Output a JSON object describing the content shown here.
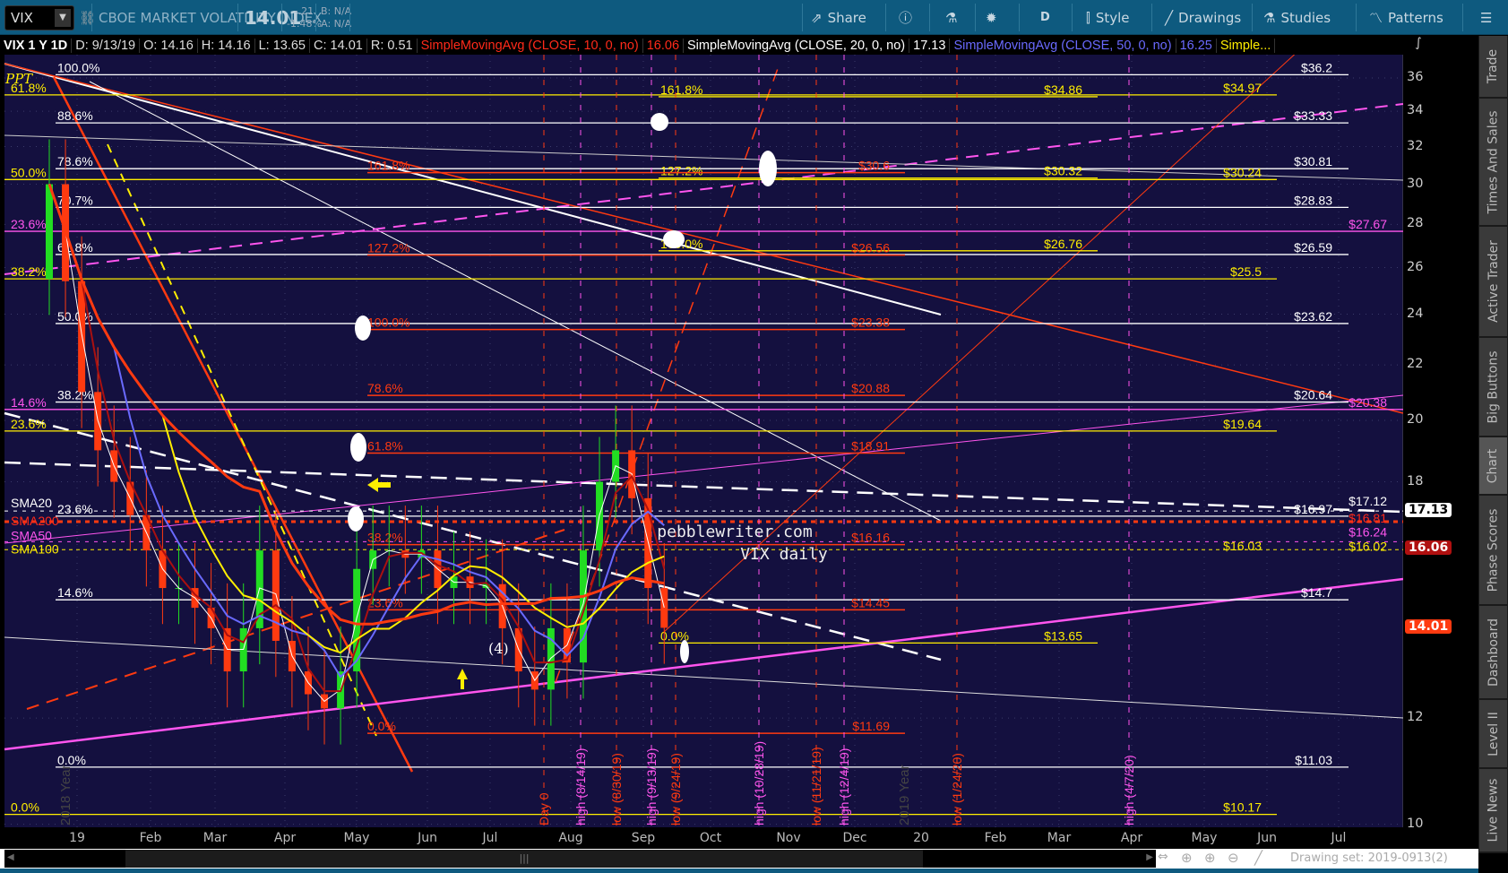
{
  "toolbar": {
    "symbol": "VIX",
    "description": "CBOE MARKET VOLATILITY INDEX",
    "last": "14.01",
    "change": "-.21",
    "change_pct": "-1.48%",
    "bid": "B: N/A",
    "ask": "A: N/A",
    "share": "Share",
    "period": "D",
    "style": "Style",
    "drawings": "Drawings",
    "studies": "Studies",
    "patterns": "Patterns"
  },
  "infobar": {
    "title": "VIX 1 Y 1D",
    "date": "D: 9/13/19",
    "open": "O: 14.16",
    "high": "H: 14.16",
    "low": "L: 13.65",
    "close": "C: 14.01",
    "range": "R: 0.51",
    "studies": [
      {
        "label": "SimpleMovingAvg (CLOSE, 10, 0, no)",
        "value": "16.06",
        "color": "#ff2a1a"
      },
      {
        "label": "SimpleMovingAvg (CLOSE, 20, 0, no)",
        "value": "17.13",
        "color": "#ffffff"
      },
      {
        "label": "SimpleMovingAvg (CLOSE, 50, 0, no)",
        "value": "16.25",
        "color": "#6a6aff"
      },
      {
        "label": "Simple...",
        "value": "",
        "color": "#ffee00"
      }
    ]
  },
  "sidebar": {
    "tabs": [
      "Trade",
      "Times And Sales",
      "Active Trader",
      "Big Buttons",
      "Chart",
      "Phase Scores",
      "Dashboard",
      "Level II",
      "Live News"
    ],
    "selected": "Chart"
  },
  "chart_data": {
    "type": "candlestick",
    "symbol": "VIX",
    "scale": "log",
    "ylim": [
      10,
      37
    ],
    "y_ticks": [
      36,
      34,
      32,
      30,
      28,
      26,
      24,
      22,
      20,
      18,
      12,
      10
    ],
    "x_ticks": [
      "19",
      "Feb",
      "Mar",
      "Apr",
      "May",
      "Jun",
      "Jul",
      "Aug",
      "Sep",
      "Oct",
      "Nov",
      "Dec",
      "20",
      "Feb",
      "Mar",
      "Apr",
      "May",
      "Jun",
      "Jul"
    ],
    "weekly_closes_from_2018_12_21": [
      30,
      25.4,
      21,
      19,
      18,
      17,
      16,
      15,
      15,
      14.5,
      14,
      13,
      14,
      16,
      13.7,
      13,
      12.5,
      12.2,
      13,
      15.5,
      16,
      16,
      15.8,
      16,
      15,
      15.3,
      15,
      15.1,
      14,
      13,
      12.6,
      14,
      13.2,
      16,
      18,
      19,
      17.5,
      15,
      14.01
    ],
    "price_tags": [
      {
        "value": "17.13",
        "bg": "#ffffff",
        "fg": "#000000"
      },
      {
        "value": "16.06",
        "bg": "#b01010",
        "fg": "#ffffff"
      },
      {
        "value": "14.01",
        "bg": "#ff3a10",
        "fg": "#ffffff"
      }
    ],
    "fib_white": [
      {
        "pct": "100.0%",
        "price": "$36.2",
        "v": 36.2
      },
      {
        "pct": "88.6%",
        "price": "$33.33",
        "v": 33.33
      },
      {
        "pct": "78.6%",
        "price": "$30.81",
        "v": 30.81
      },
      {
        "pct": "70.7%",
        "price": "$28.83",
        "v": 28.83
      },
      {
        "pct": "61.8%",
        "price": "$26.59",
        "v": 26.59
      },
      {
        "pct": "50.0%",
        "price": "$23.62",
        "v": 23.62
      },
      {
        "pct": "38.2%",
        "price": "$20.64",
        "v": 20.64
      },
      {
        "pct": "23.6%",
        "price": "$16.97",
        "v": 16.97
      },
      {
        "pct": "14.6%",
        "price": "$14.7",
        "v": 14.7
      },
      {
        "pct": "0.0%",
        "price": "$11.03",
        "v": 11.03
      }
    ],
    "fib_yellow": [
      {
        "pct": "61.8%",
        "price": "$34.97",
        "v": 34.97
      },
      {
        "pct": "50.0%",
        "price": "$30.24",
        "v": 30.24
      },
      {
        "pct": "38.2%",
        "price": "$25.5",
        "v": 25.5
      },
      {
        "pct": "23.6%",
        "price": "$19.64",
        "v": 19.64
      },
      {
        "pct": "0.0%",
        "price": "$10.17",
        "v": 10.17
      }
    ],
    "fib_magenta": [
      {
        "pct": "23.6%",
        "price": "$27.67",
        "v": 27.67
      },
      {
        "pct": "14.6%",
        "price": "$20.38",
        "v": 20.38
      }
    ],
    "fib_yellow_aug": [
      {
        "pct": "161.8%",
        "price": "$34.86",
        "v": 34.86
      },
      {
        "pct": "127.2%",
        "price": "$30.32",
        "v": 30.32
      },
      {
        "pct": "100.0%",
        "price": "$26.76",
        "v": 26.76
      },
      {
        "pct": "0.0%",
        "price": "$13.65",
        "v": 13.65
      }
    ],
    "fib_red": [
      {
        "pct": "161.8%",
        "price": "$30.6",
        "v": 30.6
      },
      {
        "pct": "127.2%",
        "price": "$26.56",
        "v": 26.56
      },
      {
        "pct": "100.0%",
        "price": "$23.38",
        "v": 23.38
      },
      {
        "pct": "78.6%",
        "price": "$20.88",
        "v": 20.88
      },
      {
        "pct": "61.8%",
        "price": "$18.91",
        "v": 18.91
      },
      {
        "pct": "38.2%",
        "price": "$16.16",
        "v": 16.16
      },
      {
        "pct": "23.6%",
        "price": "$14.45",
        "v": 14.45
      },
      {
        "pct": "0.0%",
        "price": "$11.69",
        "v": 11.69
      }
    ],
    "right_labels": [
      {
        "text": "$17.12",
        "v": 17.12,
        "color": "#ffffff"
      },
      {
        "text": "$16.81",
        "v": 16.81,
        "color": "#ff2a1a"
      },
      {
        "text": "$16.24",
        "v": 16.24,
        "color": "#ff55ee"
      },
      {
        "text": "$16.02",
        "v": 16.02,
        "color": "#ffee00"
      },
      {
        "text": "$16.03",
        "v": 16.03,
        "color": "#ffee00"
      }
    ],
    "sma_labels": [
      {
        "text": "SMA20",
        "color": "#ffffff"
      },
      {
        "text": "SMA200",
        "color": "#ff2a1a"
      },
      {
        "text": "SMA50",
        "color": "#ff55ee"
      },
      {
        "text": "SMA100",
        "color": "#ffee00"
      }
    ],
    "events": [
      {
        "text": "Day 0",
        "color": "#ff3a10"
      },
      {
        "text": "high (8/14/19)",
        "color": "#ff55ee"
      },
      {
        "text": "low (8/30/19)",
        "color": "#ff3a10"
      },
      {
        "text": "high (9/13/19)",
        "color": "#ff55ee"
      },
      {
        "text": "low (9/24/19)",
        "color": "#ff3a10"
      },
      {
        "text": "high (10/28/19)",
        "color": "#ff55ee"
      },
      {
        "text": "low (11/21/19)",
        "color": "#ff3a10"
      },
      {
        "text": "high (12/4/19)",
        "color": "#ff55ee"
      },
      {
        "text": "low (1/24/20)",
        "color": "#ff3a10"
      },
      {
        "text": "high (4/7/20)",
        "color": "#ff55ee"
      }
    ],
    "year_labels": [
      "2018 Year",
      "2019 Year"
    ],
    "annotations": {
      "watermark1": "pebblewriter.com",
      "watermark2": "VIX daily",
      "wave": "(4)",
      "ppt": "PPT"
    }
  },
  "footer": {
    "drawing_set": "Drawing set: 2019-0913(2)"
  }
}
